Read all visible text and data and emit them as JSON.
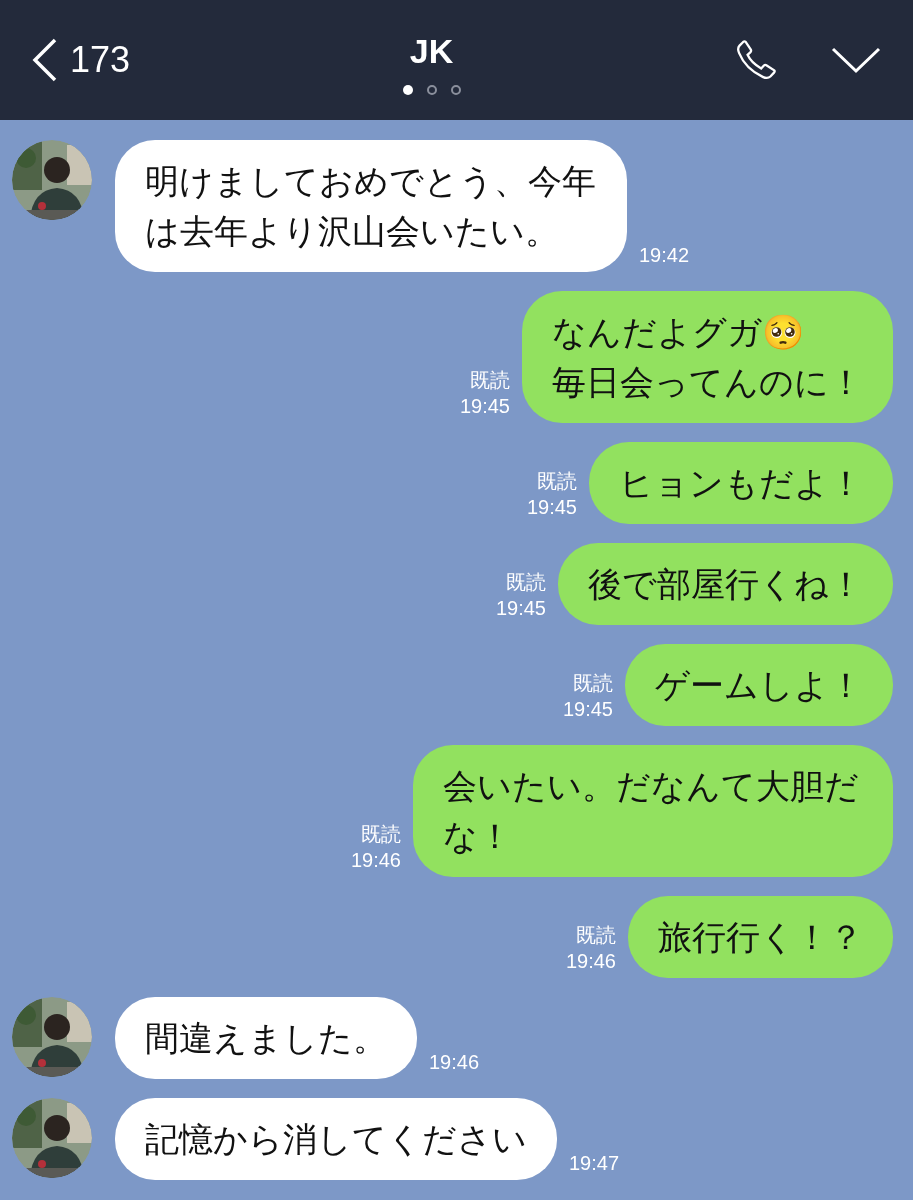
{
  "header": {
    "back_label": "173",
    "title": "JK",
    "pages": [
      {
        "selected": true
      },
      {
        "selected": false
      },
      {
        "selected": false
      }
    ]
  },
  "messages": [
    {
      "kind": "incoming",
      "text": "明けましておめでとう、今年は去年より沢山会いたい。",
      "time": "19:42"
    },
    {
      "kind": "outgoing",
      "text": "なんだよグガ🥺\n毎日会ってんのに！",
      "read": "既読",
      "time": "19:45"
    },
    {
      "kind": "outgoing",
      "text": "ヒョンもだよ！",
      "read": "既読",
      "time": "19:45"
    },
    {
      "kind": "outgoing",
      "text": "後で部屋行くね！",
      "read": "既読",
      "time": "19:45"
    },
    {
      "kind": "outgoing",
      "text": "ゲームしよ！",
      "read": "既読",
      "time": "19:45"
    },
    {
      "kind": "outgoing",
      "text": "会いたい。だなんて大胆だな！",
      "read": "既読",
      "time": "19:46"
    },
    {
      "kind": "outgoing",
      "text": "旅行行く！？",
      "read": "既読",
      "time": "19:46"
    },
    {
      "kind": "incoming",
      "text": "間違えました。",
      "time": "19:46"
    },
    {
      "kind": "incoming",
      "text": "記憶から消してください",
      "time": "19:47"
    }
  ]
}
